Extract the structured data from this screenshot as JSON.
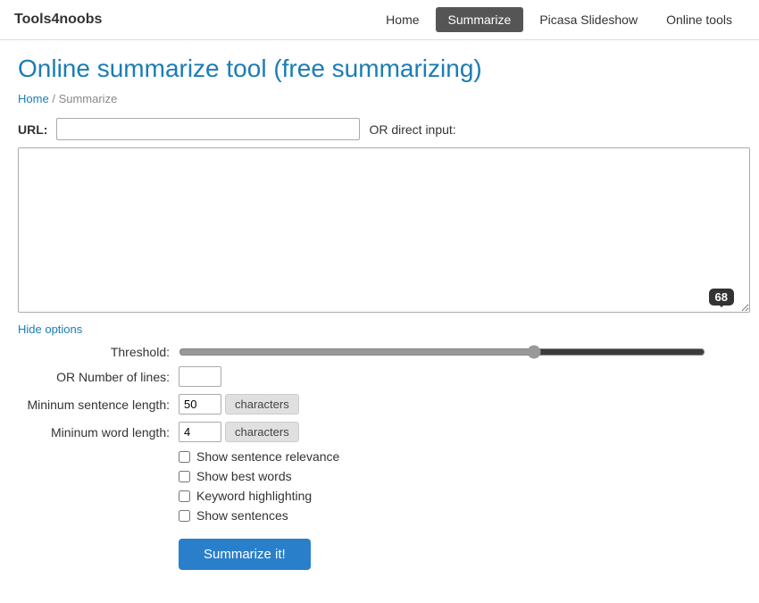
{
  "nav": {
    "logo": "Tools4noobs",
    "links": [
      {
        "label": "Home",
        "active": false
      },
      {
        "label": "Summarize",
        "active": true
      },
      {
        "label": "Picasa Slideshow",
        "active": false
      },
      {
        "label": "Online tools",
        "active": false
      }
    ]
  },
  "page": {
    "title": "Online summarize tool (free summarizing)",
    "breadcrumb_home": "Home",
    "breadcrumb_separator": "/",
    "breadcrumb_current": "Summarize"
  },
  "form": {
    "url_label": "URL:",
    "url_placeholder": "",
    "or_direct_label": "OR direct input:",
    "textarea_placeholder": "",
    "hide_options_label": "Hide options",
    "threshold_label": "Threshold:",
    "threshold_value": 68,
    "lines_label": "OR Number of lines:",
    "min_sentence_label": "Mininum sentence length:",
    "min_sentence_value": "50",
    "min_sentence_unit": "characters",
    "min_word_label": "Mininum word length:",
    "min_word_value": "4",
    "min_word_unit": "characters",
    "checkboxes": [
      {
        "label": "Show sentence relevance",
        "checked": false
      },
      {
        "label": "Show best words",
        "checked": false
      },
      {
        "label": "Keyword highlighting",
        "checked": false
      },
      {
        "label": "Show sentences",
        "checked": false
      }
    ],
    "submit_label": "Summarize it!"
  }
}
